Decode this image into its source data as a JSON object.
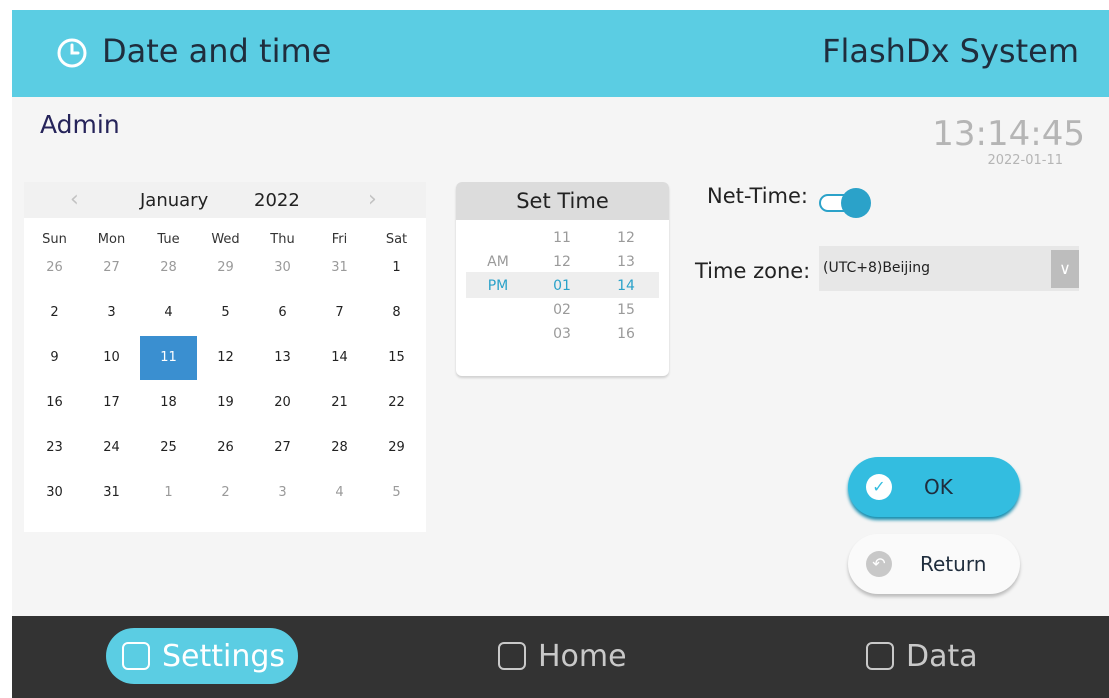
{
  "header": {
    "title": "Date and time",
    "brand": "FlashDx System",
    "icon": "clock-icon"
  },
  "user": "Admin",
  "clock": {
    "time": "13:14:45",
    "date": "2022-01-11"
  },
  "calendar": {
    "month": "January",
    "year": "2022",
    "weekdays": [
      "Sun",
      "Mon",
      "Tue",
      "Wed",
      "Thu",
      "Fri",
      "Sat"
    ],
    "weeks": [
      [
        "26",
        "27",
        "28",
        "29",
        "30",
        "31",
        "1"
      ],
      [
        "2",
        "3",
        "4",
        "5",
        "6",
        "7",
        "8"
      ],
      [
        "9",
        "10",
        "11",
        "12",
        "13",
        "14",
        "15"
      ],
      [
        "16",
        "17",
        "18",
        "19",
        "20",
        "21",
        "22"
      ],
      [
        "23",
        "24",
        "25",
        "26",
        "27",
        "28",
        "29"
      ],
      [
        "30",
        "31",
        "1",
        "2",
        "3",
        "4",
        "5"
      ]
    ],
    "selected": "11"
  },
  "time_picker": {
    "title": "Set Time",
    "ampm": [
      "AM",
      "PM"
    ],
    "hours": [
      "11",
      "12",
      "01",
      "02",
      "03"
    ],
    "minutes": [
      "12",
      "13",
      "14",
      "15",
      "16"
    ],
    "selected": {
      "ampm": "PM",
      "hour": "01",
      "minute": "14"
    }
  },
  "net_time": {
    "label": "Net-Time:",
    "enabled": true
  },
  "timezone": {
    "label": "Time zone:",
    "value": "(UTC+8)Beijing"
  },
  "buttons": {
    "ok": "OK",
    "return": "Return"
  },
  "nav": {
    "settings": "Settings",
    "home": "Home",
    "data": "Data",
    "active": "settings"
  },
  "colors": {
    "accent": "#5bcde3",
    "button": "#33bde0",
    "selected_day": "#3a8fd0",
    "active_text": "#2ba2c9",
    "nav_bg": "#333333"
  }
}
